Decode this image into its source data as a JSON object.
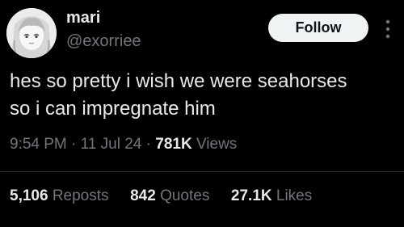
{
  "author": {
    "display_name": "mari",
    "handle": "@exorriee",
    "avatar_icon": "anime-girl-avatar"
  },
  "actions": {
    "follow_label": "Follow",
    "more_icon": "more-vertical-icon"
  },
  "tweet": {
    "lines": [
      "hes so pretty i wish we were seahorses",
      "so i can impregnate him"
    ]
  },
  "meta": {
    "time": "9:54 PM",
    "separator": "·",
    "date": "11 Jul 24",
    "views_count": "781K",
    "views_label": "Views"
  },
  "stats": {
    "reposts_count": "5,106",
    "reposts_label": "Reposts",
    "quotes_count": "842",
    "quotes_label": "Quotes",
    "likes_count": "27.1K",
    "likes_label": "Likes"
  },
  "colors": {
    "background": "#000000",
    "primary_text": "#e7e9ea",
    "secondary_text": "#71767b",
    "follow_button_bg": "#eff3f4",
    "follow_button_text": "#0f1419",
    "divider": "#2f3336"
  }
}
